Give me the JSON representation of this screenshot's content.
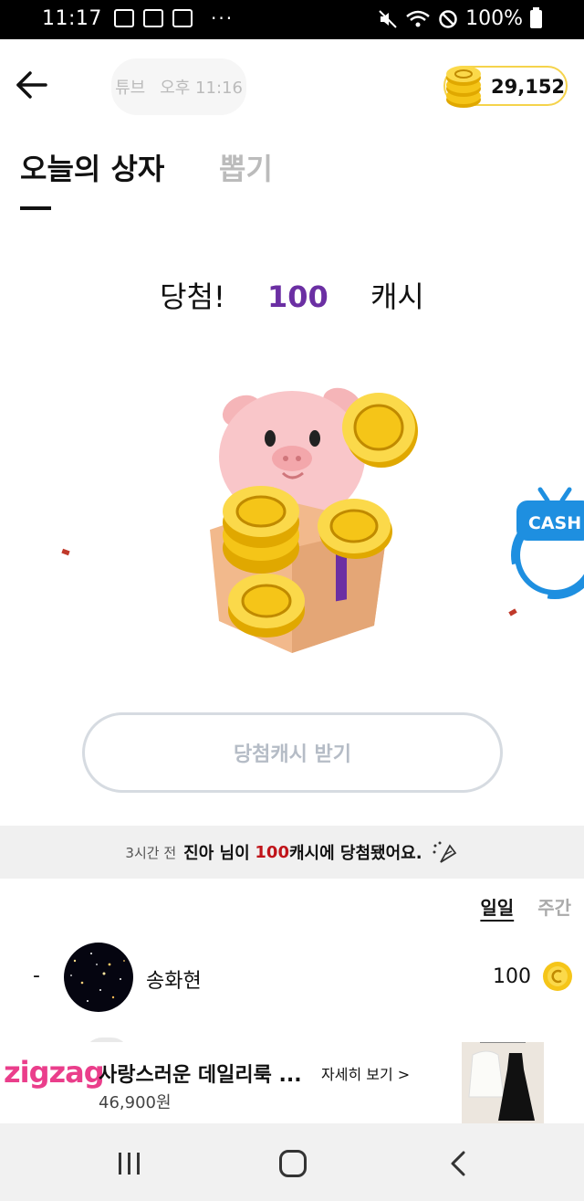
{
  "status_bar": {
    "time": "11:17",
    "battery": "100%",
    "dots": "···"
  },
  "header": {
    "ghost_pill_left": "튜브",
    "ghost_pill_right": "오후 11:16",
    "coin_balance": "29,152"
  },
  "tabs": {
    "active": "오늘의 상자",
    "inactive": "뽑기"
  },
  "result": {
    "prefix": "당첨!",
    "amount": "100",
    "suffix": "캐시"
  },
  "badge": {
    "label": "CASH"
  },
  "claim_button": {
    "label": "당첨캐시 받기"
  },
  "notice": {
    "ago": "3시간 전",
    "name": "진아 님이",
    "win_amount": "100",
    "win_suffix": "캐시에 당첨됐어요."
  },
  "period_tabs": {
    "daily": "일일",
    "weekly": "주간"
  },
  "ranking": [
    {
      "rank": "-",
      "name": "송화현",
      "score": "100"
    }
  ],
  "ad": {
    "brand": "zigzag",
    "title": "사랑스러운 데일리룩 ...",
    "price": "46,900원",
    "more": "자세히 보기 >"
  },
  "colors": {
    "accent_purple": "#6b2fa3",
    "win_red": "#c0141a",
    "coin_gold": "#f5d34b",
    "brand_pink": "#ea3e8b",
    "badge_blue": "#1e8fe0"
  }
}
